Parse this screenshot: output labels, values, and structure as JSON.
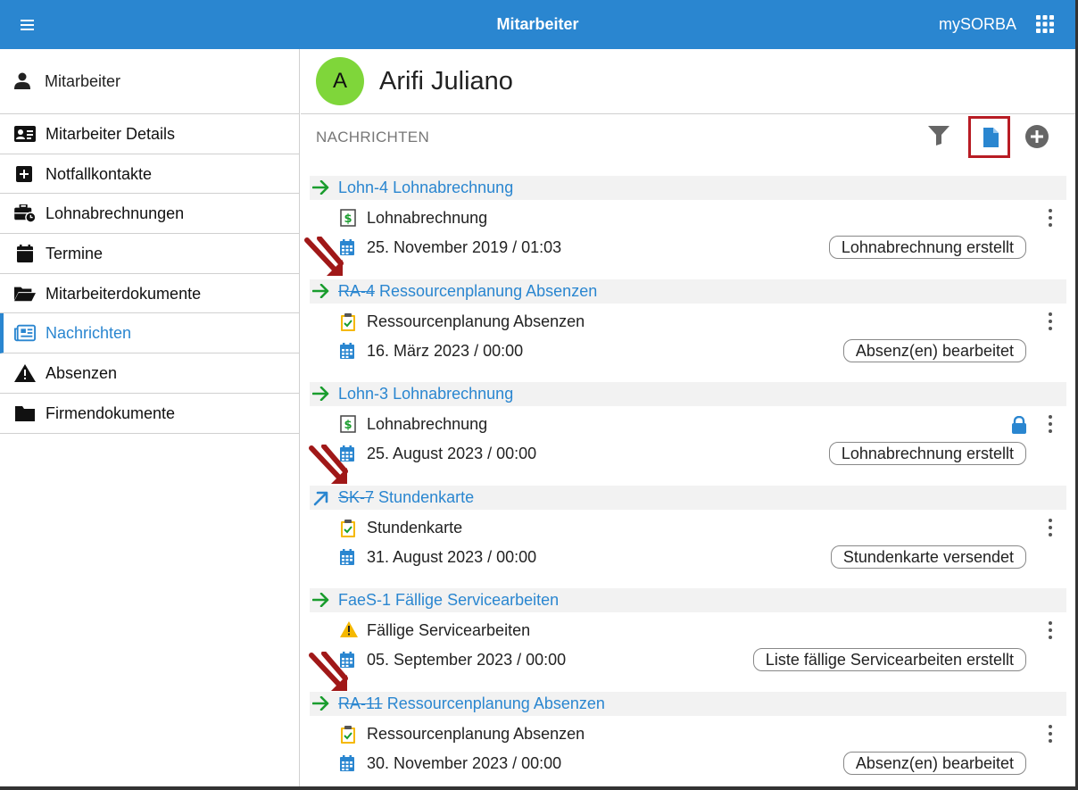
{
  "header": {
    "title": "Mitarbeiter",
    "brand": "mySORBA",
    "bg_color": "#2a86d0"
  },
  "sidebar": {
    "heading": "Mitarbeiter",
    "items": [
      {
        "label": "Mitarbeiter Details",
        "icon": "id-card-icon"
      },
      {
        "label": "Notfallkontakte",
        "icon": "plus-square-icon"
      },
      {
        "label": "Lohnabrechnungen",
        "icon": "briefcase-clock-icon"
      },
      {
        "label": "Termine",
        "icon": "calendar-icon"
      },
      {
        "label": "Mitarbeiterdokumente",
        "icon": "folder-open-icon"
      },
      {
        "label": "Nachrichten",
        "icon": "newspaper-icon",
        "active": true
      },
      {
        "label": "Absenzen",
        "icon": "warning-icon"
      },
      {
        "label": "Firmendokumente",
        "icon": "folder-icon"
      }
    ]
  },
  "employee": {
    "initial": "A",
    "name": "Arifi Juliano",
    "avatar_color": "#7fd63a"
  },
  "section": {
    "title": "NACHRICHTEN"
  },
  "messages": [
    {
      "arrow": "right",
      "ref_struck": "",
      "ref_plain": "Lohn-4",
      "title": "Lohnabrechnung",
      "type_icon": "dollar-doc-icon",
      "type_label": "Lohnabrechnung",
      "date": "25. November 2019 / 01:03",
      "status": "Lohnabrechnung erstellt",
      "locked": false
    },
    {
      "arrow": "right",
      "ref_struck": "RA-4",
      "ref_plain": "",
      "title": "Ressourcenplanung Absenzen",
      "type_icon": "clipboard-check-icon",
      "type_label": "Ressourcenplanung Absenzen",
      "date": "16. März 2023 / 00:00",
      "status": "Absenz(en) bearbeitet",
      "locked": false
    },
    {
      "arrow": "right",
      "ref_struck": "",
      "ref_plain": "Lohn-3",
      "title": "Lohnabrechnung",
      "type_icon": "dollar-doc-icon",
      "type_label": "Lohnabrechnung",
      "date": "25. August 2023 / 00:00",
      "status": "Lohnabrechnung erstellt",
      "locked": true
    },
    {
      "arrow": "diagonal",
      "ref_struck": "SK-7",
      "ref_plain": "",
      "title": "Stundenkarte",
      "type_icon": "clipboard-check-icon",
      "type_label": "Stundenkarte",
      "date": "31. August 2023 / 00:00",
      "status": "Stundenkarte  versendet",
      "locked": false
    },
    {
      "arrow": "right",
      "ref_struck": "",
      "ref_plain": "FaeS-1",
      "title": "Fällige Servicearbeiten",
      "type_icon": "warning-icon",
      "type_label": "Fällige Servicearbeiten",
      "date": "05. September 2023 / 00:00",
      "status": "Liste fällige Servicearbeiten erstellt",
      "locked": false
    },
    {
      "arrow": "right",
      "ref_struck": "RA-11",
      "ref_plain": "",
      "title": "Ressourcenplanung Absenzen",
      "type_icon": "clipboard-check-icon",
      "type_label": "Ressourcenplanung Absenzen",
      "date": "30. November 2023 / 00:00",
      "status": "Absenz(en) bearbeitet",
      "locked": false
    }
  ]
}
